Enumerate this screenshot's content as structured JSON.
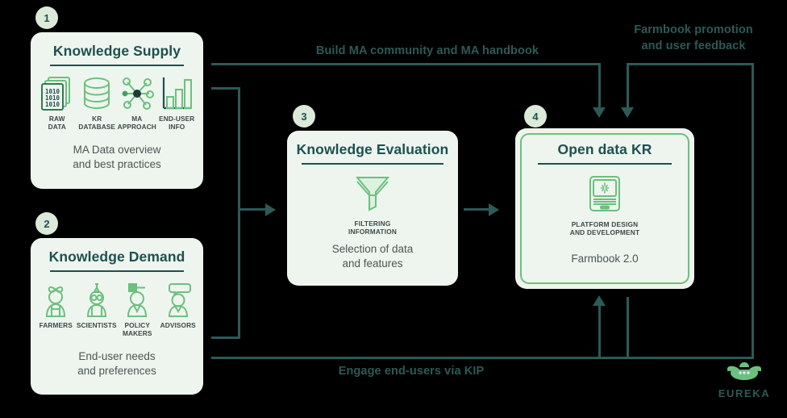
{
  "theme": {
    "background": "#000000",
    "card_bg": "#eef5ee",
    "card_border": "#6cc07e",
    "title_color": "#1d5050",
    "line_color": "#2b5a57",
    "icon_green": "#6cc07e",
    "badge_bg": "#dcead9",
    "body_text": "#4a5656"
  },
  "cards": [
    {
      "badge": "1",
      "title": "Knowledge Supply",
      "icons": [
        {
          "name": "raw-data-icon",
          "caption": "RAW\nDATA"
        },
        {
          "name": "kr-database-icon",
          "caption": "KR\nDATABASE"
        },
        {
          "name": "ma-approach-icon",
          "caption": "MA\nAPPROACH"
        },
        {
          "name": "end-user-info-icon",
          "caption": "END-USER\nINFO"
        }
      ],
      "icon_captions": [
        "RAW DATA",
        "KR DATABASE",
        "MA APPROACH",
        "END-USER INFO"
      ],
      "description": "MA Data overview\nand best practices",
      "data_glyph": "1010"
    },
    {
      "badge": "2",
      "title": "Knowledge Demand",
      "icons": [
        {
          "name": "farmer-icon",
          "caption": "FARMERS"
        },
        {
          "name": "scientist-icon",
          "caption": "SCIENTISTS"
        },
        {
          "name": "policy-maker-icon",
          "caption": "POLICY\nMAKERS"
        },
        {
          "name": "advisor-icon",
          "caption": "ADVISORS"
        }
      ],
      "description": "End-user needs\nand preferences"
    },
    {
      "badge": "3",
      "title": "Knowledge Evaluation",
      "icon": {
        "name": "funnel-icon",
        "caption": "FILTERING\nINFORMATION"
      },
      "description": "Selection of data\nand features"
    },
    {
      "badge": "4",
      "title": "Open data KR",
      "icon": {
        "name": "laptop-platform-icon",
        "caption": "PLATFORM DESIGN\nAND DEVELOPMENT"
      },
      "description": "Farmbook 2.0"
    }
  ],
  "flows": {
    "top_left": "Build MA community and MA handbook",
    "top_right": "Farmbook promotion\nand user feedback",
    "bottom": "Engage end-users via KIP"
  },
  "logo": {
    "name": "eureka-logo",
    "word": "EUREKA"
  }
}
